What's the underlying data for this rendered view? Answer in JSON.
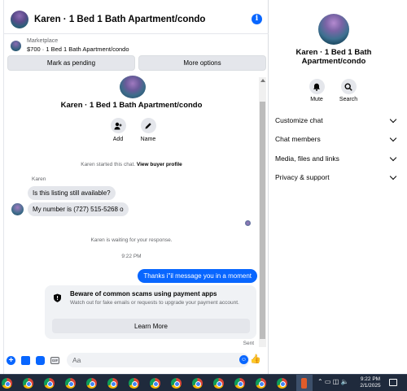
{
  "header": {
    "title": "Karen · 1 Bed 1 Bath Apartment/condo",
    "info_glyph": "i"
  },
  "listing": {
    "label": "Marketplace",
    "price_title": "$700 · 1 Bed 1 Bath Apartment/condo"
  },
  "actions": {
    "pending_label": "Mark as pending",
    "more_label": "More options"
  },
  "profile": {
    "name": "Karen · 1 Bed 1 Bath Apartment/condo",
    "add_label": "Add",
    "name_label": "Name"
  },
  "thread": {
    "started_text": "Karen started this chat.",
    "view_profile": "View buyer profile",
    "sender": "Karen",
    "msg1": "Is this listing still available?",
    "msg2": "My number is (727) 515-5268 o",
    "waiting": "Karen is waiting for your response.",
    "time": "9:22 PM",
    "outgoing": "Thanks i\"il message you in a moment",
    "sent": "Sent"
  },
  "warning": {
    "title": "Beware of common scams using payment apps",
    "body": "Watch out for fake emails or requests to upgrade your payment account.",
    "button": "Learn More"
  },
  "composer": {
    "placeholder": "Aa",
    "gif": "GIF"
  },
  "side": {
    "name": "Karen · 1 Bed 1 Bath Apartment/condo",
    "mute": "Mute",
    "search": "Search",
    "rows": [
      "Customize chat",
      "Chat members",
      "Media, files and links",
      "Privacy & support"
    ]
  },
  "taskbar": {
    "time": "9:22 PM",
    "date": "2/1/2025"
  },
  "colors": {
    "accent": "#0866ff",
    "bubble_in": "#e4e6eb",
    "taskbar": "#1f2a3c"
  }
}
